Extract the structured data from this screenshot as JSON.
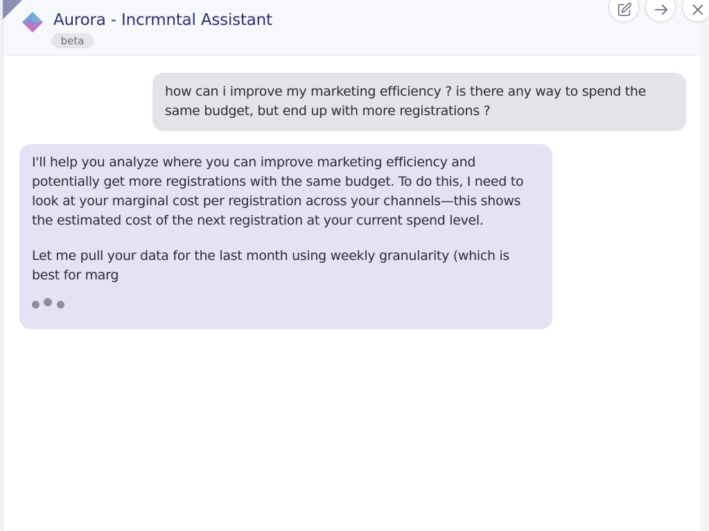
{
  "window": {
    "title": "Aurora - Incrmntal Assistant",
    "badge": "beta"
  },
  "header_actions": {
    "edit_icon": "edit-icon",
    "forward_icon": "arrow-right-icon",
    "close_icon": "close-icon"
  },
  "conversation": {
    "user_message": "how can i improve my marketing efficiency ? is there any way to spend the same budget, but end up with more registrations ?",
    "assistant_message": {
      "paragraph_1": "I'll help you analyze where you can improve marketing efficiency and potentially get more registrations with the same budget. To do this, I need to look at your marginal cost per registration across your channels—this shows the estimated cost of the next registration at your current spend level.",
      "paragraph_2": "Let me pull your data for the last month using weekly granularity (which is best for marg"
    },
    "typing_indicator": "typing-dots-icon"
  },
  "colors": {
    "title": "#2b2f6b",
    "user_bubble": "#e2e4e9",
    "assistant_bubble": "#e6e1f5",
    "header_bg": "#f7f8fc"
  }
}
